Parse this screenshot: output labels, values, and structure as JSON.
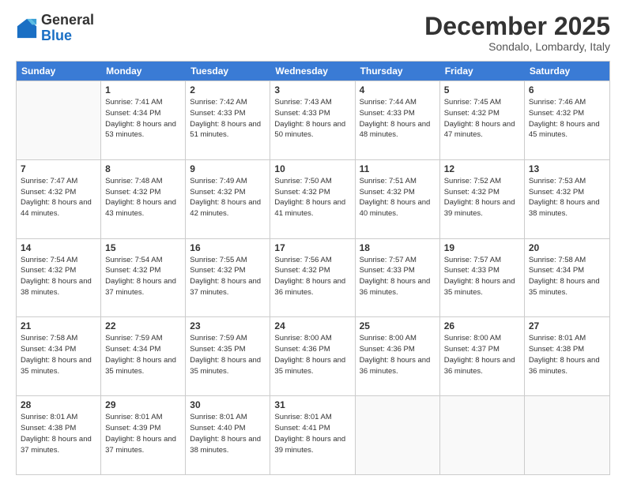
{
  "logo": {
    "general": "General",
    "blue": "Blue"
  },
  "header": {
    "month": "December 2025",
    "location": "Sondalo, Lombardy, Italy"
  },
  "days": [
    "Sunday",
    "Monday",
    "Tuesday",
    "Wednesday",
    "Thursday",
    "Friday",
    "Saturday"
  ],
  "weeks": [
    [
      {
        "day": "",
        "sunrise": "",
        "sunset": "",
        "daylight": ""
      },
      {
        "day": "1",
        "sunrise": "Sunrise: 7:41 AM",
        "sunset": "Sunset: 4:34 PM",
        "daylight": "Daylight: 8 hours and 53 minutes."
      },
      {
        "day": "2",
        "sunrise": "Sunrise: 7:42 AM",
        "sunset": "Sunset: 4:33 PM",
        "daylight": "Daylight: 8 hours and 51 minutes."
      },
      {
        "day": "3",
        "sunrise": "Sunrise: 7:43 AM",
        "sunset": "Sunset: 4:33 PM",
        "daylight": "Daylight: 8 hours and 50 minutes."
      },
      {
        "day": "4",
        "sunrise": "Sunrise: 7:44 AM",
        "sunset": "Sunset: 4:33 PM",
        "daylight": "Daylight: 8 hours and 48 minutes."
      },
      {
        "day": "5",
        "sunrise": "Sunrise: 7:45 AM",
        "sunset": "Sunset: 4:32 PM",
        "daylight": "Daylight: 8 hours and 47 minutes."
      },
      {
        "day": "6",
        "sunrise": "Sunrise: 7:46 AM",
        "sunset": "Sunset: 4:32 PM",
        "daylight": "Daylight: 8 hours and 45 minutes."
      }
    ],
    [
      {
        "day": "7",
        "sunrise": "Sunrise: 7:47 AM",
        "sunset": "Sunset: 4:32 PM",
        "daylight": "Daylight: 8 hours and 44 minutes."
      },
      {
        "day": "8",
        "sunrise": "Sunrise: 7:48 AM",
        "sunset": "Sunset: 4:32 PM",
        "daylight": "Daylight: 8 hours and 43 minutes."
      },
      {
        "day": "9",
        "sunrise": "Sunrise: 7:49 AM",
        "sunset": "Sunset: 4:32 PM",
        "daylight": "Daylight: 8 hours and 42 minutes."
      },
      {
        "day": "10",
        "sunrise": "Sunrise: 7:50 AM",
        "sunset": "Sunset: 4:32 PM",
        "daylight": "Daylight: 8 hours and 41 minutes."
      },
      {
        "day": "11",
        "sunrise": "Sunrise: 7:51 AM",
        "sunset": "Sunset: 4:32 PM",
        "daylight": "Daylight: 8 hours and 40 minutes."
      },
      {
        "day": "12",
        "sunrise": "Sunrise: 7:52 AM",
        "sunset": "Sunset: 4:32 PM",
        "daylight": "Daylight: 8 hours and 39 minutes."
      },
      {
        "day": "13",
        "sunrise": "Sunrise: 7:53 AM",
        "sunset": "Sunset: 4:32 PM",
        "daylight": "Daylight: 8 hours and 38 minutes."
      }
    ],
    [
      {
        "day": "14",
        "sunrise": "Sunrise: 7:54 AM",
        "sunset": "Sunset: 4:32 PM",
        "daylight": "Daylight: 8 hours and 38 minutes."
      },
      {
        "day": "15",
        "sunrise": "Sunrise: 7:54 AM",
        "sunset": "Sunset: 4:32 PM",
        "daylight": "Daylight: 8 hours and 37 minutes."
      },
      {
        "day": "16",
        "sunrise": "Sunrise: 7:55 AM",
        "sunset": "Sunset: 4:32 PM",
        "daylight": "Daylight: 8 hours and 37 minutes."
      },
      {
        "day": "17",
        "sunrise": "Sunrise: 7:56 AM",
        "sunset": "Sunset: 4:32 PM",
        "daylight": "Daylight: 8 hours and 36 minutes."
      },
      {
        "day": "18",
        "sunrise": "Sunrise: 7:57 AM",
        "sunset": "Sunset: 4:33 PM",
        "daylight": "Daylight: 8 hours and 36 minutes."
      },
      {
        "day": "19",
        "sunrise": "Sunrise: 7:57 AM",
        "sunset": "Sunset: 4:33 PM",
        "daylight": "Daylight: 8 hours and 35 minutes."
      },
      {
        "day": "20",
        "sunrise": "Sunrise: 7:58 AM",
        "sunset": "Sunset: 4:34 PM",
        "daylight": "Daylight: 8 hours and 35 minutes."
      }
    ],
    [
      {
        "day": "21",
        "sunrise": "Sunrise: 7:58 AM",
        "sunset": "Sunset: 4:34 PM",
        "daylight": "Daylight: 8 hours and 35 minutes."
      },
      {
        "day": "22",
        "sunrise": "Sunrise: 7:59 AM",
        "sunset": "Sunset: 4:34 PM",
        "daylight": "Daylight: 8 hours and 35 minutes."
      },
      {
        "day": "23",
        "sunrise": "Sunrise: 7:59 AM",
        "sunset": "Sunset: 4:35 PM",
        "daylight": "Daylight: 8 hours and 35 minutes."
      },
      {
        "day": "24",
        "sunrise": "Sunrise: 8:00 AM",
        "sunset": "Sunset: 4:36 PM",
        "daylight": "Daylight: 8 hours and 35 minutes."
      },
      {
        "day": "25",
        "sunrise": "Sunrise: 8:00 AM",
        "sunset": "Sunset: 4:36 PM",
        "daylight": "Daylight: 8 hours and 36 minutes."
      },
      {
        "day": "26",
        "sunrise": "Sunrise: 8:00 AM",
        "sunset": "Sunset: 4:37 PM",
        "daylight": "Daylight: 8 hours and 36 minutes."
      },
      {
        "day": "27",
        "sunrise": "Sunrise: 8:01 AM",
        "sunset": "Sunset: 4:38 PM",
        "daylight": "Daylight: 8 hours and 36 minutes."
      }
    ],
    [
      {
        "day": "28",
        "sunrise": "Sunrise: 8:01 AM",
        "sunset": "Sunset: 4:38 PM",
        "daylight": "Daylight: 8 hours and 37 minutes."
      },
      {
        "day": "29",
        "sunrise": "Sunrise: 8:01 AM",
        "sunset": "Sunset: 4:39 PM",
        "daylight": "Daylight: 8 hours and 37 minutes."
      },
      {
        "day": "30",
        "sunrise": "Sunrise: 8:01 AM",
        "sunset": "Sunset: 4:40 PM",
        "daylight": "Daylight: 8 hours and 38 minutes."
      },
      {
        "day": "31",
        "sunrise": "Sunrise: 8:01 AM",
        "sunset": "Sunset: 4:41 PM",
        "daylight": "Daylight: 8 hours and 39 minutes."
      },
      {
        "day": "",
        "sunrise": "",
        "sunset": "",
        "daylight": ""
      },
      {
        "day": "",
        "sunrise": "",
        "sunset": "",
        "daylight": ""
      },
      {
        "day": "",
        "sunrise": "",
        "sunset": "",
        "daylight": ""
      }
    ]
  ]
}
